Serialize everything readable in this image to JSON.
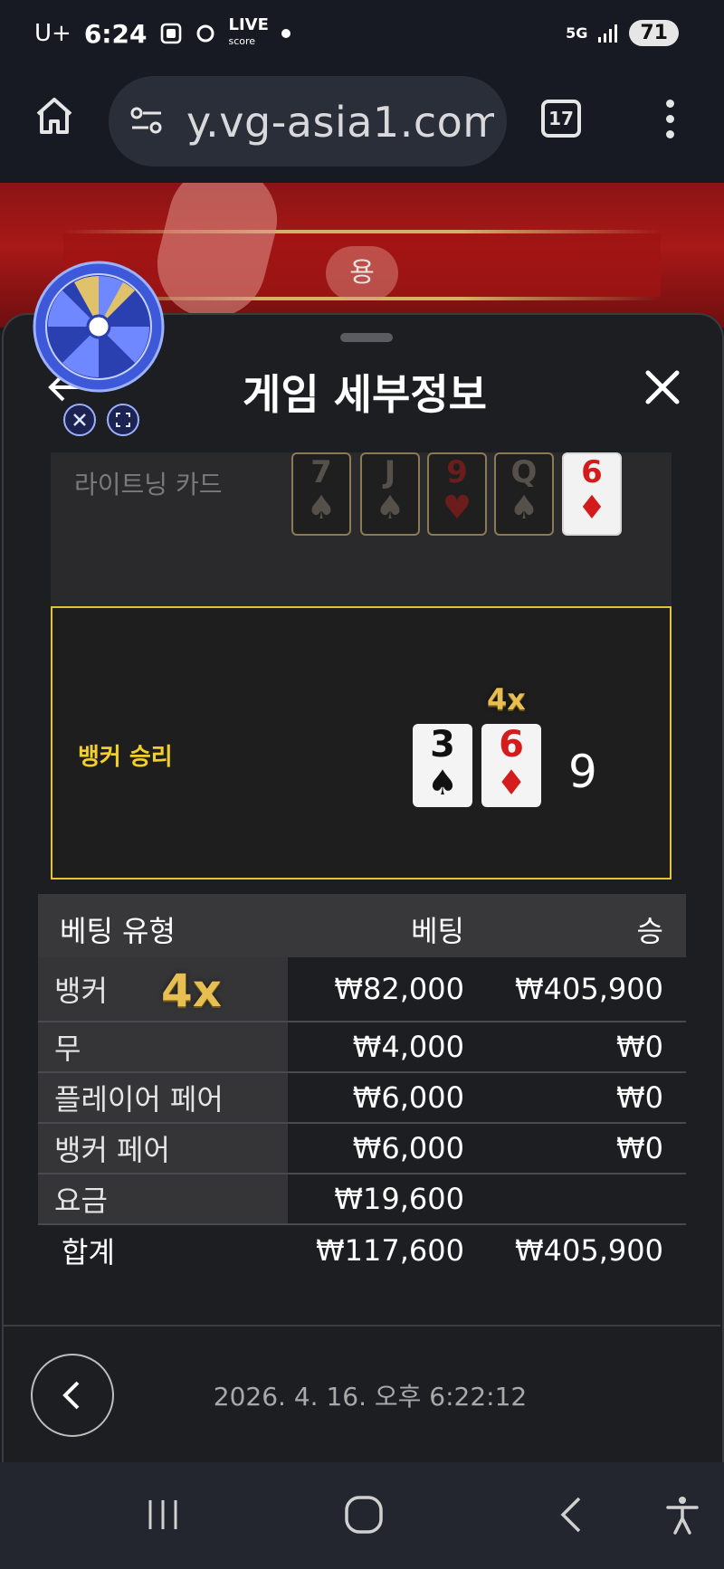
{
  "status_bar": {
    "carrier": "U+",
    "time": "6:24",
    "live_label_1": "LIVE",
    "live_label_2": "score",
    "network": "5G",
    "battery": "71"
  },
  "browser": {
    "url": "y.vg-asia1.com",
    "tab_count": "17"
  },
  "video": {
    "table_label": "용"
  },
  "panel": {
    "title": "게임 세부정보"
  },
  "lightning": {
    "label": "라이트닝 카드",
    "cards": [
      {
        "rank": "7",
        "suit": "♠",
        "color": "black",
        "highlight": false
      },
      {
        "rank": "J",
        "suit": "♠",
        "color": "black",
        "highlight": false
      },
      {
        "rank": "9",
        "suit": "♥",
        "color": "red",
        "highlight": false
      },
      {
        "rank": "Q",
        "suit": "♠",
        "color": "black",
        "highlight": false
      },
      {
        "rank": "6",
        "suit": "♦",
        "color": "red",
        "highlight": true
      }
    ]
  },
  "result": {
    "label": "뱅커 승리",
    "multiplier": "4x",
    "cards": [
      {
        "rank": "3",
        "suit": "♠",
        "color": "black"
      },
      {
        "rank": "6",
        "suit": "♦",
        "color": "red"
      }
    ],
    "score": "9"
  },
  "bets": {
    "headers": {
      "type": "베팅 유형",
      "bet": "베팅",
      "win": "승"
    },
    "rows": [
      {
        "type": "뱅커",
        "multiplier": "4x",
        "bet": "₩82,000",
        "win": "₩405,900"
      },
      {
        "type": "무",
        "bet": "₩4,000",
        "win": "₩0"
      },
      {
        "type": "플레이어 페어",
        "bet": "₩6,000",
        "win": "₩0"
      },
      {
        "type": "뱅커 페어",
        "bet": "₩6,000",
        "win": "₩0"
      },
      {
        "type": "요금",
        "bet": "₩19,600",
        "win": ""
      }
    ],
    "total": {
      "type": "합계",
      "bet": "₩117,600",
      "win": "₩405,900"
    }
  },
  "footer": {
    "timestamp": "2026. 4. 16. 오후 6:22:12"
  },
  "colors": {
    "accent_gold": "#e2c33a",
    "panel_bg": "#1d1e22",
    "video_red": "#a81818"
  }
}
